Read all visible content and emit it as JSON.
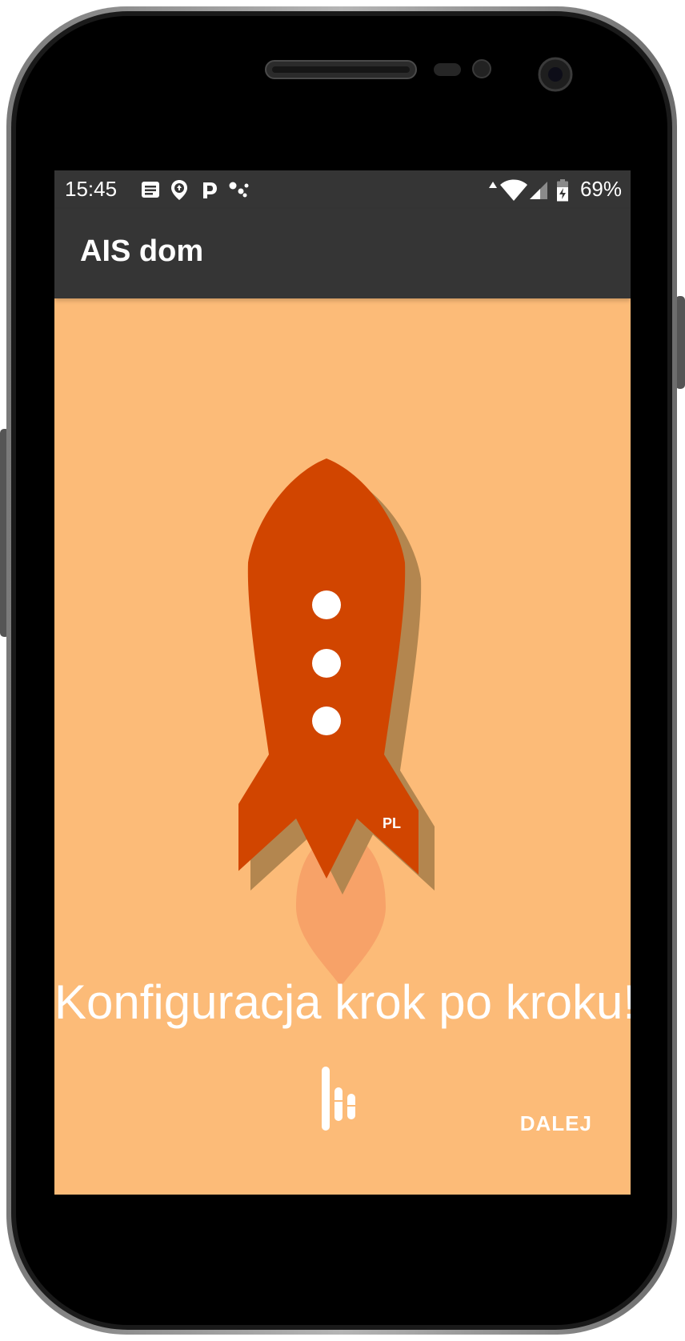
{
  "status_bar": {
    "time": "15:45",
    "notification_icons": [
      "news-icon",
      "location-upload-icon",
      "parking-icon",
      "assistant-icon"
    ],
    "network_icons": [
      "data-arrow-icon",
      "wifi-icon",
      "signal-icon"
    ],
    "battery_icon": "battery-charging-icon",
    "battery_level": "69%"
  },
  "app_bar": {
    "title": "AIS dom"
  },
  "onboarding": {
    "illustration": "rocket-icon",
    "badge": "PL",
    "headline": "Konfiguracja krok po kroku!",
    "logo": "ais-dom-logo-icon",
    "next_label": "DALEJ"
  },
  "colors": {
    "screen_background": "#fcbb78",
    "bar_background": "#353535",
    "rocket_body": "#d14500",
    "rocket_shadow": "#b3864f",
    "flame": "#f7a067",
    "text": "#ffffff"
  }
}
